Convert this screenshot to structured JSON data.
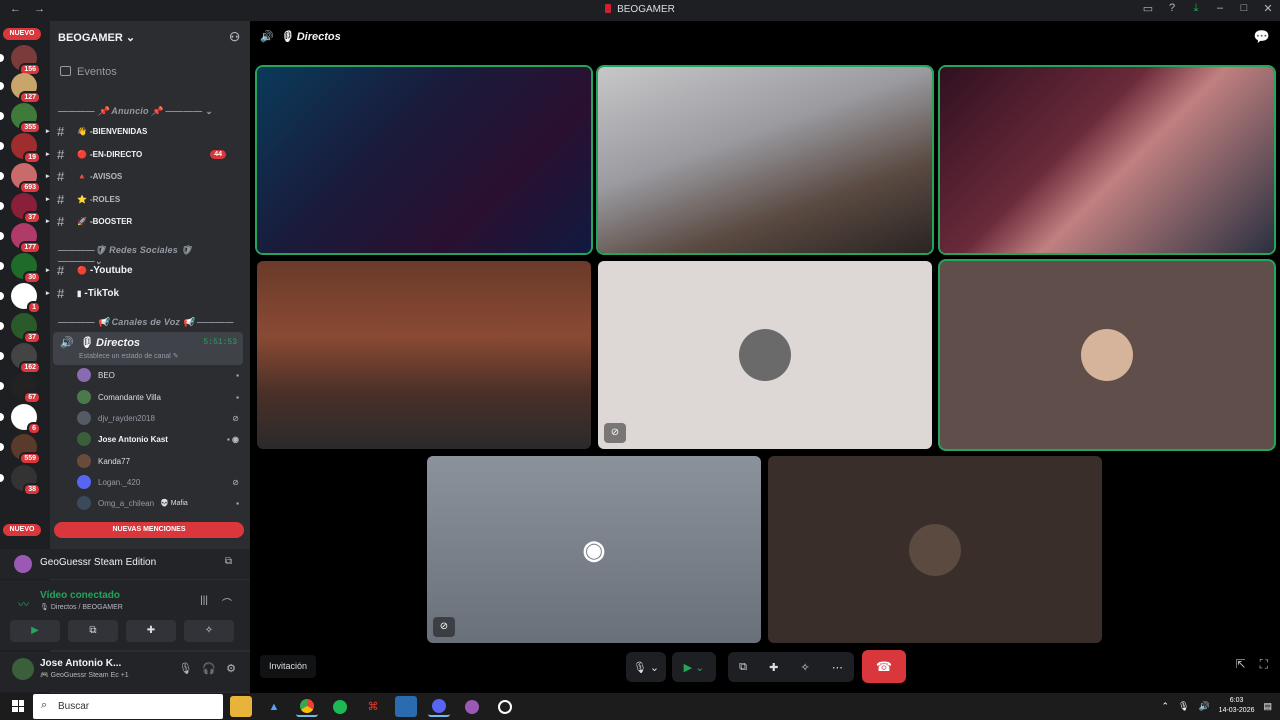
{
  "window": {
    "title": "BEOGAMER",
    "nav_back": "←",
    "nav_forward": "→",
    "icons": [
      "monitor-icon",
      "help-icon",
      "download-icon",
      "minimize-icon",
      "maximize-icon",
      "close-icon"
    ]
  },
  "servers": {
    "new_pill_top": "NUEVO",
    "new_pill_bottom": "NUEVO",
    "items": [
      {
        "badge": "156",
        "color": "#7a3b3b"
      },
      {
        "badge": "127",
        "color": "#c9a46b"
      },
      {
        "badge": "355",
        "color": "#3f7a3a"
      },
      {
        "badge": "19",
        "color": "#a02d2d"
      },
      {
        "badge": "693",
        "color": "#c96b6b"
      },
      {
        "badge": "37",
        "color": "#8a1f3a"
      },
      {
        "badge": "177",
        "color": "#b03a6a"
      },
      {
        "badge": "30",
        "color": "#1f6b2a"
      },
      {
        "badge": "1",
        "color": "#ffffff"
      },
      {
        "badge": "37",
        "color": "#2a5a2a"
      },
      {
        "badge": "162",
        "color": "#444444"
      },
      {
        "badge": "67",
        "color": "#222222"
      },
      {
        "badge": "6",
        "color": "#ffffff"
      },
      {
        "badge": "559",
        "color": "#5a3a2a"
      },
      {
        "badge": "38",
        "color": "#333333"
      }
    ]
  },
  "sidebar": {
    "guild_name": "BEOGAMER",
    "guild_caret": "⌄",
    "events_label": "Eventos",
    "categories": [
      {
        "label": "―――― 📌 Anuncio 📌 ―――― ⌄"
      },
      {
        "label": "――――🛡 Redes Sociales 🛡 ――――⌄"
      },
      {
        "label": "―――― 📢 Canales de Voz 📢 ―――― ⌄"
      }
    ],
    "text_channels": [
      {
        "emoji": "👋",
        "label": "-BIENVENIDAS",
        "white": true,
        "mention": ""
      },
      {
        "emoji": "🔴",
        "label": "-EN-DIRECTO",
        "white": true,
        "mention": "44"
      },
      {
        "emoji": "🔺",
        "label": "-AVISOS",
        "white": false,
        "mention": ""
      },
      {
        "emoji": "⭐",
        "label": "-ROLES",
        "white": false,
        "mention": ""
      },
      {
        "emoji": "🚀",
        "label": "-BOOSTER",
        "white": true,
        "mention": ""
      },
      {
        "emoji": "🔴",
        "label": "-Youtube",
        "white": true,
        "mention": ""
      },
      {
        "emoji": "▮",
        "label": "-TikTok",
        "white": true,
        "mention": ""
      }
    ],
    "voice_channel": {
      "name": "🎙 Directos",
      "timer": "5:51:53",
      "status": "Establece un estado de canal ✎"
    },
    "voice_users": [
      {
        "name": "BEO",
        "style": "normal",
        "avatar": "#8a6bb0",
        "icon": "▪"
      },
      {
        "name": "Comandante Villa",
        "style": "normal",
        "avatar": "#4a7a4a",
        "icon": "▪"
      },
      {
        "name": "djv_rayden2018",
        "style": "dim",
        "avatar": "#555a63",
        "icon": "⊘"
      },
      {
        "name": "Jose Antonio Kast",
        "style": "bold",
        "avatar": "#3a5f3a",
        "icon": "▪ ◉"
      },
      {
        "name": "Kanda77",
        "style": "normal",
        "avatar": "#6a4a3a",
        "icon": ""
      },
      {
        "name": "Logan._420",
        "style": "dim",
        "avatar": "#5865f2",
        "icon": "⊘"
      },
      {
        "name": "Omg_a_chilean",
        "style": "dim",
        "avatar": "#3a4a5a",
        "icon": "▪",
        "tag": "💀 Mafia"
      }
    ],
    "new_mentions": "NUEVAS MENCIONES"
  },
  "activity": {
    "game": "GeoGuessr Steam Edition"
  },
  "voice_panel": {
    "connected": "Vídeo conectado",
    "location": "🎙 Directos / BEOGAMER"
  },
  "user": {
    "name": "Jose Antonio K...",
    "status": "🎮 GeoGuessr Steam Ec +1"
  },
  "stage": {
    "channel_title": "🎙 Directos",
    "invite_label": "Invitación",
    "tiles": [
      {
        "kind": "video",
        "bg": "linear-gradient(135deg,#0a3a5a,#1a1a3a 40%,#2a1030 70%,#101a40)"
      },
      {
        "kind": "video",
        "bg": "linear-gradient(160deg,#c7c7c9,#9a9aa0 40%,#5a4a42 70%,#2a2422)"
      },
      {
        "kind": "video",
        "bg": "linear-gradient(135deg,#301020,#6a2a3a 40%,#c08080 55%,#2a3040)"
      },
      {
        "kind": "video",
        "bg": "linear-gradient(180deg,#6a3a2a,#8a4a34 40%,#4a3028 70%,#2a2a2a)"
      },
      {
        "kind": "avatar",
        "bg": "#ddd7d5",
        "avatar": "#6a6a6a",
        "muted": true
      },
      {
        "kind": "avatar",
        "bg": "#5f4e49",
        "avatar": "#d6b49c",
        "muted": false
      },
      {
        "kind": "discord",
        "bg": "linear-gradient(180deg,#8b929b,#6a7079)",
        "muted": true
      },
      {
        "kind": "avatar",
        "bg": "#3a2e2a",
        "avatar": "#5a4a40",
        "muted": false
      }
    ]
  }
}
